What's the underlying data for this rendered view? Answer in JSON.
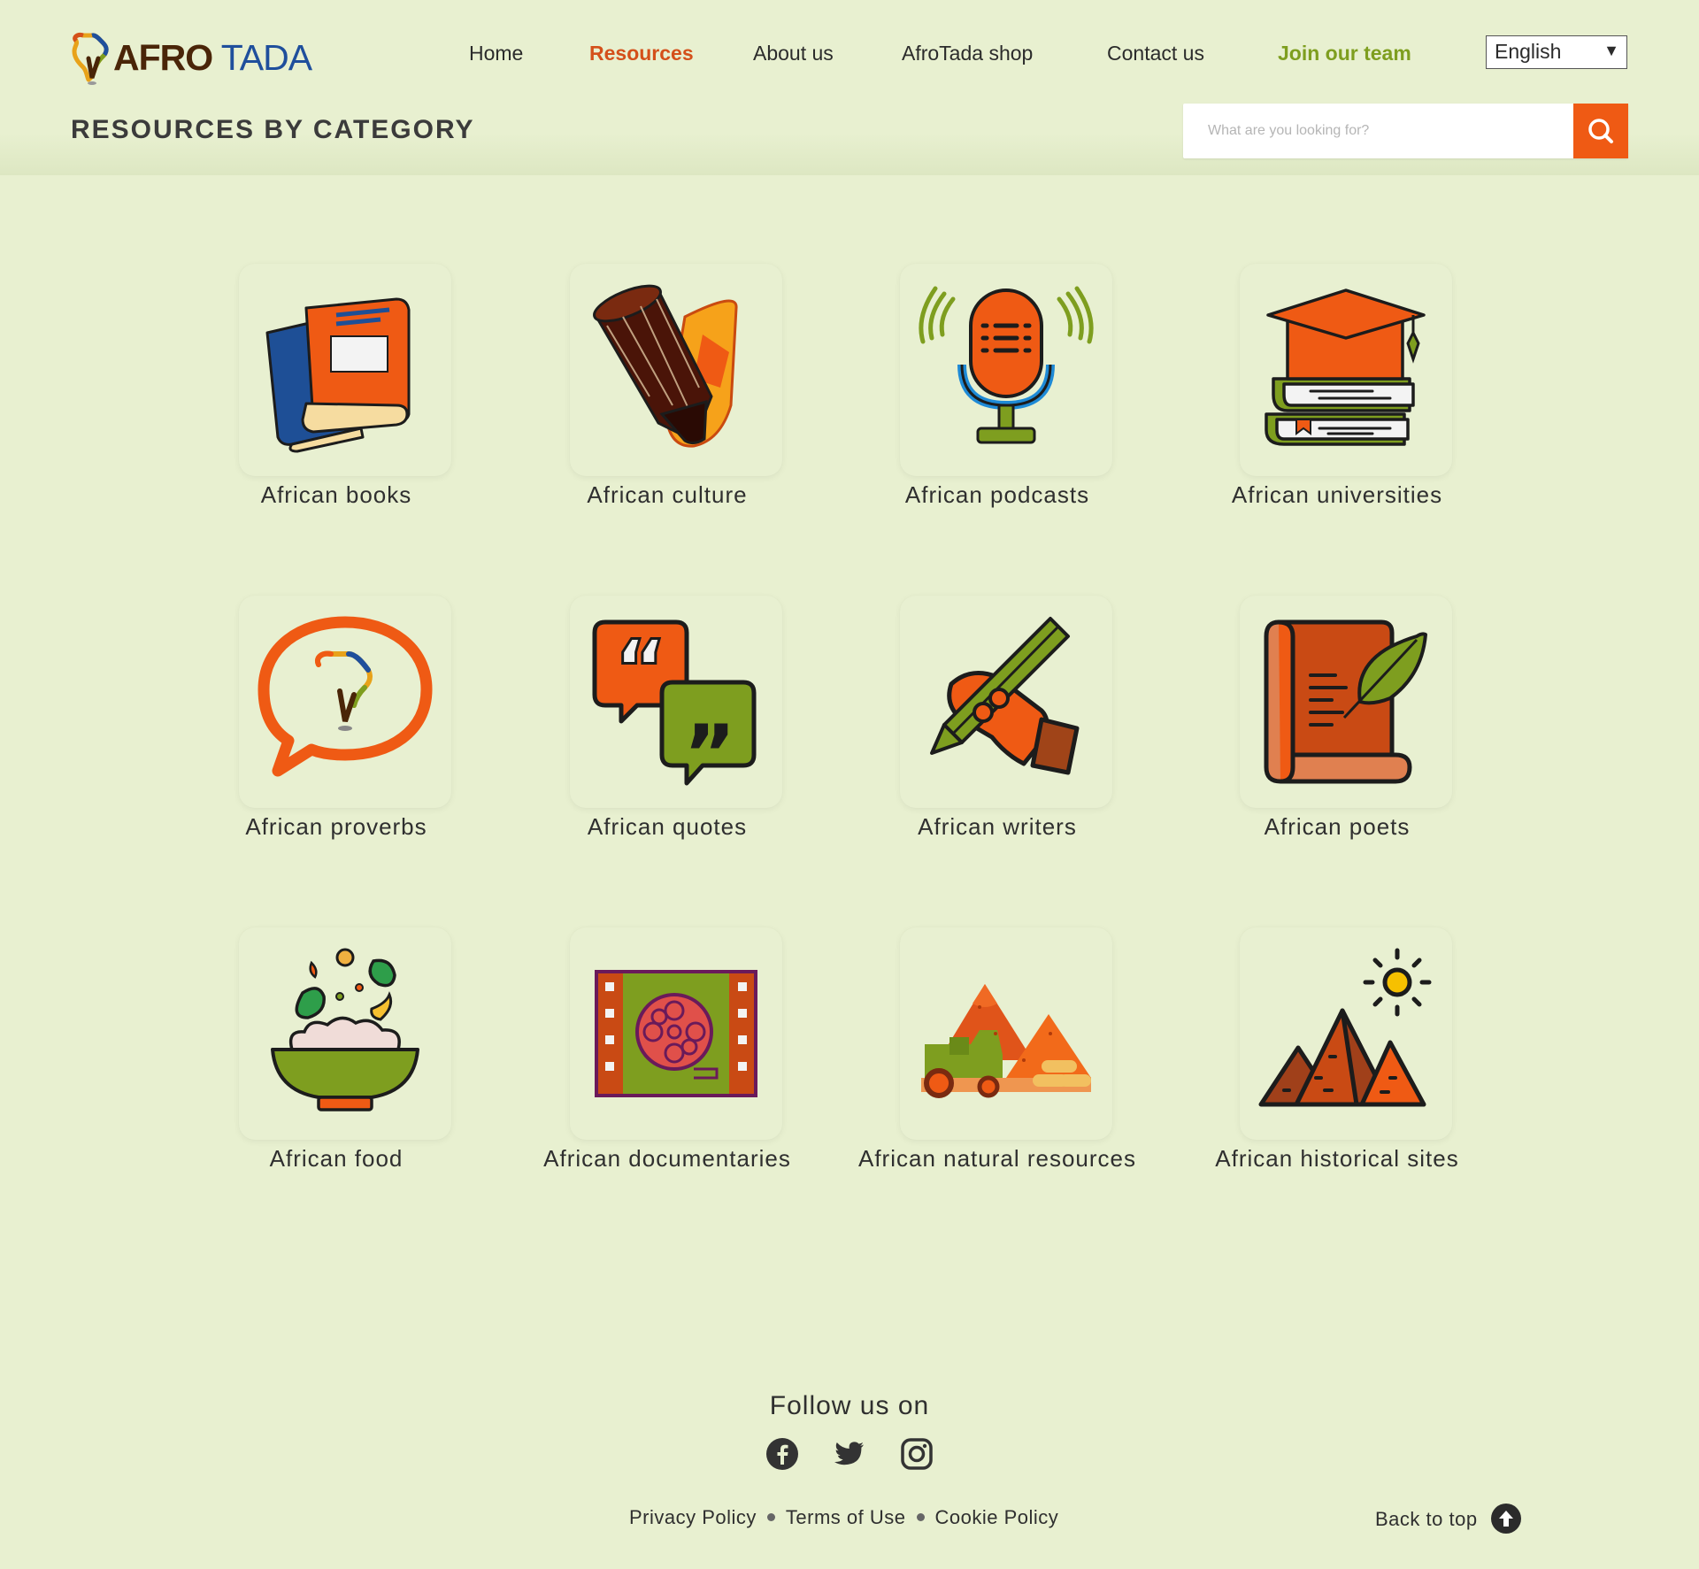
{
  "brand": {
    "logo_word1": "AFRO",
    "logo_word2": " TADA"
  },
  "nav": {
    "items": [
      {
        "label": "Home"
      },
      {
        "label": "Resources"
      },
      {
        "label": "About us"
      },
      {
        "label": "AfroTada shop"
      },
      {
        "label": "Contact us"
      },
      {
        "label": "Join our team"
      }
    ],
    "language": "English"
  },
  "page": {
    "heading": "RESOURCES BY CATEGORY"
  },
  "search": {
    "placeholder": "What are you looking for?"
  },
  "categories": [
    {
      "label": "African books",
      "icon": "books-icon"
    },
    {
      "label": "African culture",
      "icon": "drum-icon"
    },
    {
      "label": "African podcasts",
      "icon": "microphone-icon"
    },
    {
      "label": "African universities",
      "icon": "graduation-books-icon"
    },
    {
      "label": "African proverbs",
      "icon": "speech-bubble-africa-icon"
    },
    {
      "label": "African quotes",
      "icon": "quote-bubbles-icon"
    },
    {
      "label": "African writers",
      "icon": "writing-hand-icon"
    },
    {
      "label": "African poets",
      "icon": "scroll-quill-icon"
    },
    {
      "label": "African food",
      "icon": "food-bowl-icon"
    },
    {
      "label": "African documentaries",
      "icon": "film-reel-icon"
    },
    {
      "label": "African natural resources",
      "icon": "mining-icon"
    },
    {
      "label": "African historical sites",
      "icon": "pyramids-icon"
    }
  ],
  "footer": {
    "follow": "Follow us on",
    "social": [
      "facebook-icon",
      "twitter-icon",
      "instagram-icon"
    ],
    "links": [
      {
        "label": "Privacy Policy"
      },
      {
        "label": "Terms of Use"
      },
      {
        "label": "Cookie Policy"
      }
    ],
    "back_to_top": "Back to top"
  },
  "colors": {
    "background": "#e8f0d0",
    "accent_orange": "#ef5a14",
    "accent_green": "#7e9e1f",
    "active_nav": "#d4501a"
  }
}
